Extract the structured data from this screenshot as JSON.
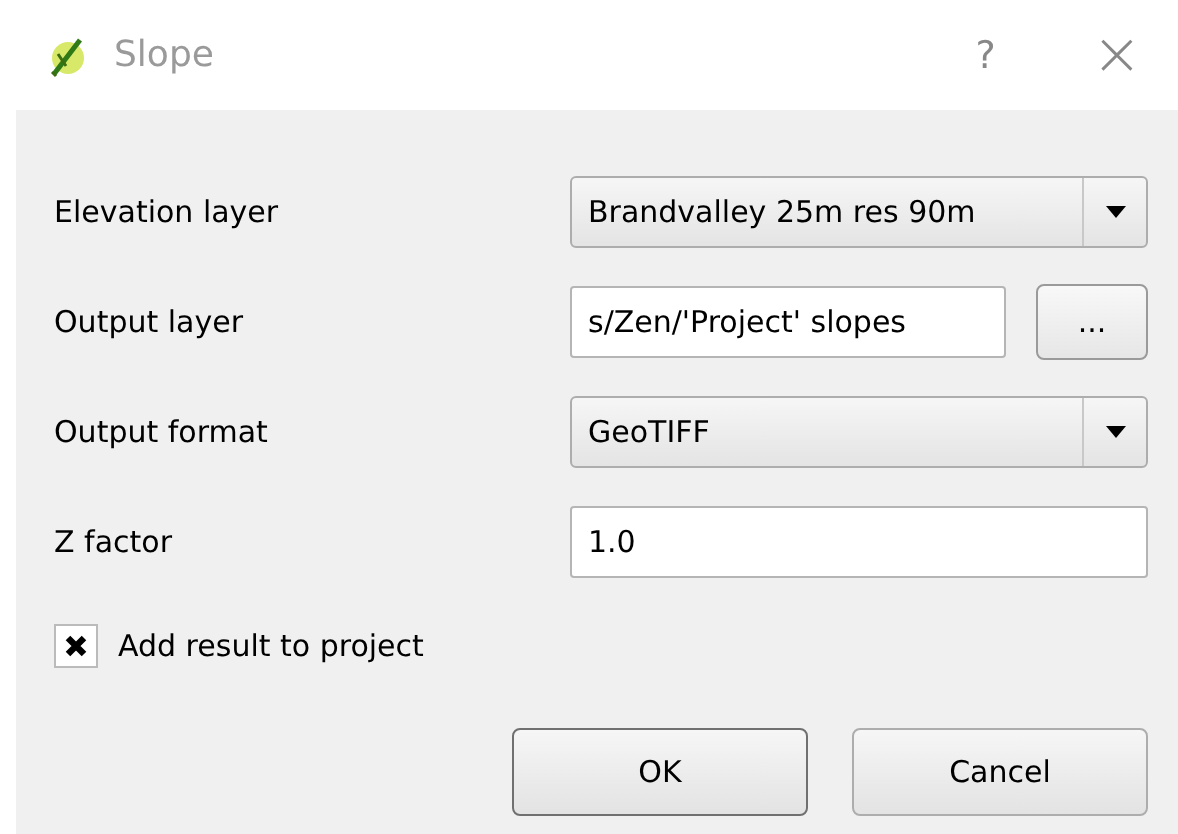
{
  "window": {
    "title": "Slope",
    "help": "?",
    "close": "×"
  },
  "fields": [
    {
      "label": "Elevation layer",
      "kind": "combo",
      "value": "Brandvalley 25m res 90m"
    },
    {
      "label": "Output layer",
      "kind": "file",
      "value": "s/Zen/'Project' slopes",
      "browse": "..."
    },
    {
      "label": "Output format",
      "kind": "combo",
      "value": "GeoTIFF"
    },
    {
      "label": "Z factor",
      "kind": "text",
      "value": "1.0"
    }
  ],
  "add_to_project": {
    "label": "Add result to project",
    "checked": true
  },
  "buttons": [
    "OK",
    "Cancel"
  ]
}
